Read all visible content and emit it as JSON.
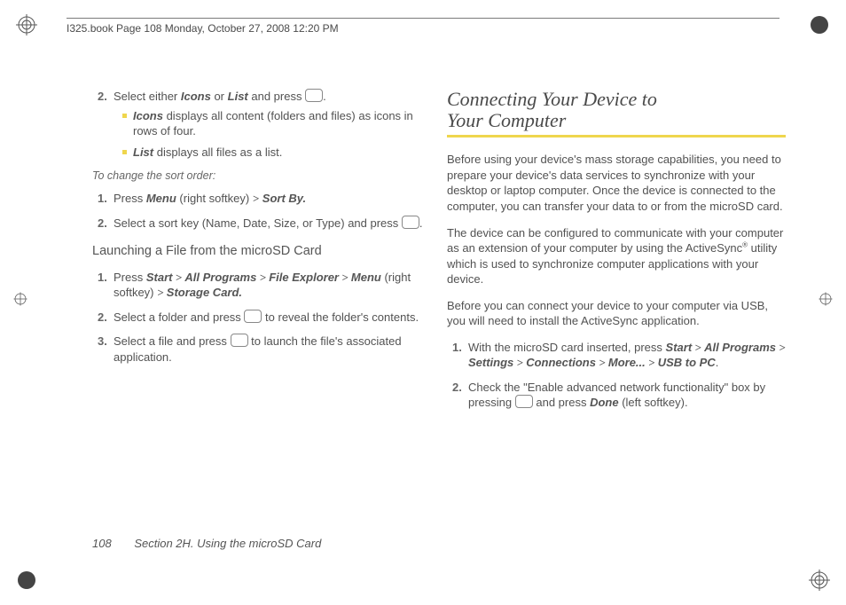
{
  "topbar": "I325.book  Page 108  Monday, October 27, 2008  12:20 PM",
  "left": {
    "step2_lead": "Select either ",
    "step2_icons": "Icons",
    "step2_or": " or ",
    "step2_list": "List",
    "step2_tail": " and press ",
    "step2_end": ".",
    "bullet1_icons": "Icons",
    "bullet1_text": " displays all content (folders and files) as icons in rows of four.",
    "bullet2_list": "List",
    "bullet2_text": " displays all files as a list.",
    "sortcaption": "To change the sort order:",
    "sort1_press": "Press ",
    "sort1_menu": "Menu",
    "sort1_softkey": " (right softkey) ",
    "sort1_gt": ">",
    "sort1_sortby": " Sort By.",
    "sort2_text": "Select a sort key (Name, Date, Size, or Type) and press ",
    "sort2_end": ".",
    "launch_heading": "Launching a File from the microSD Card",
    "l1_press": "Press ",
    "l1_start": "Start",
    "l1_gt1": " > ",
    "l1_allprog": "All Programs",
    "l1_gt2": " > ",
    "l1_fileexp": "File Explorer",
    "l1_gt3": " > ",
    "l1_menu": "Menu",
    "l1_softkey": " (right softkey) ",
    "l1_gt4": "> ",
    "l1_storage": "Storage Card.",
    "l2_a": "Select a folder and press ",
    "l2_b": " to reveal the folder's contents.",
    "l3_a": "Select a file and press ",
    "l3_b": " to launch the file's associated application."
  },
  "right": {
    "heading_line1": "Connecting Your Device to",
    "heading_line2": "Your Computer",
    "p1": "Before using your device's mass storage capabilities, you need to prepare your device's data services to synchronize with your desktop or laptop computer. Once the device is connected to the computer, you can transfer your data to or from the microSD card.",
    "p2a": "The device can be configured to communicate with your computer as an extension of your computer by using the ActiveSync",
    "p2sup": "®",
    "p2b": " utility which is used to synchronize computer applications with your device.",
    "p3": "Before you can connect your device to your computer via USB, you will need to install the ActiveSync application.",
    "r1_a": "With the microSD card inserted, press ",
    "r1_start": "Start",
    "r1_gt1": " > ",
    "r1_allprog": "All Programs",
    "r1_gt2": " > ",
    "r1_settings": "Settings",
    "r1_gt3": " > ",
    "r1_conn": "Connections",
    "r1_gt4": " > ",
    "r1_more": "More...",
    "r1_gt5": " > ",
    "r1_usb": "USB to PC",
    "r1_end": ".",
    "r2_a": "Check the \"Enable advanced network functionality\" box by pressing ",
    "r2_b": " and press ",
    "r2_done": "Done",
    "r2_c": " (left softkey)."
  },
  "footer": {
    "page": "108",
    "section": "Section 2H. Using the microSD Card"
  }
}
